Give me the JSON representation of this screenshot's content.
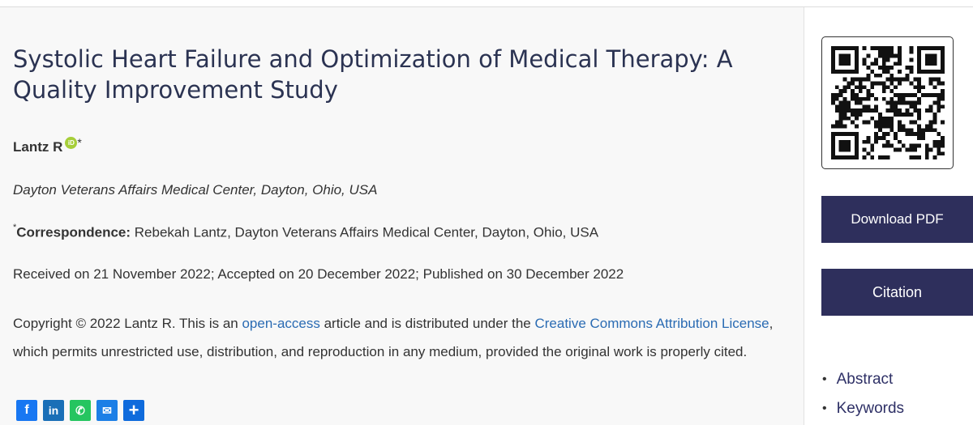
{
  "article": {
    "title": "Systolic Heart Failure and Optimization of Medical Therapy: A Quality Improvement Study",
    "author": "Lantz R",
    "author_marker": "*",
    "orcid_label": "iD",
    "affiliation": "Dayton Veterans Affairs Medical Center, Dayton, Ohio, USA",
    "correspondence_marker": "*",
    "correspondence_label": "Correspondence:",
    "correspondence_text": " Rebekah Lantz, Dayton Veterans Affairs Medical Center, Dayton, Ohio, USA",
    "dates": "Received on 21 November 2022; Accepted on 20 December 2022; Published on 30 December 2022",
    "copyright_pre": "Copyright © 2022 Lantz R. This is an ",
    "copyright_link1": "open-access",
    "copyright_mid": " article and is distributed under the ",
    "copyright_link2": "Creative Commons Attribution License",
    "copyright_post": ", which permits unrestricted use, distribution, and reproduction in any medium, provided the original work is properly cited."
  },
  "share": {
    "facebook": "f",
    "linkedin": "in",
    "whatsapp": "✆",
    "email": "✉",
    "more": "+"
  },
  "sidebar": {
    "download_pdf": "Download PDF",
    "citation": "Citation",
    "toc": [
      "Abstract",
      "Keywords"
    ]
  },
  "colors": {
    "title": "#2b3352",
    "link": "#2a6bb3",
    "button_bg": "#2e2f5c",
    "orcid": "#a6ce39"
  },
  "icons": [
    "qr-code-icon",
    "orcid-icon",
    "facebook-icon",
    "linkedin-icon",
    "whatsapp-icon",
    "email-icon",
    "share-plus-icon"
  ]
}
